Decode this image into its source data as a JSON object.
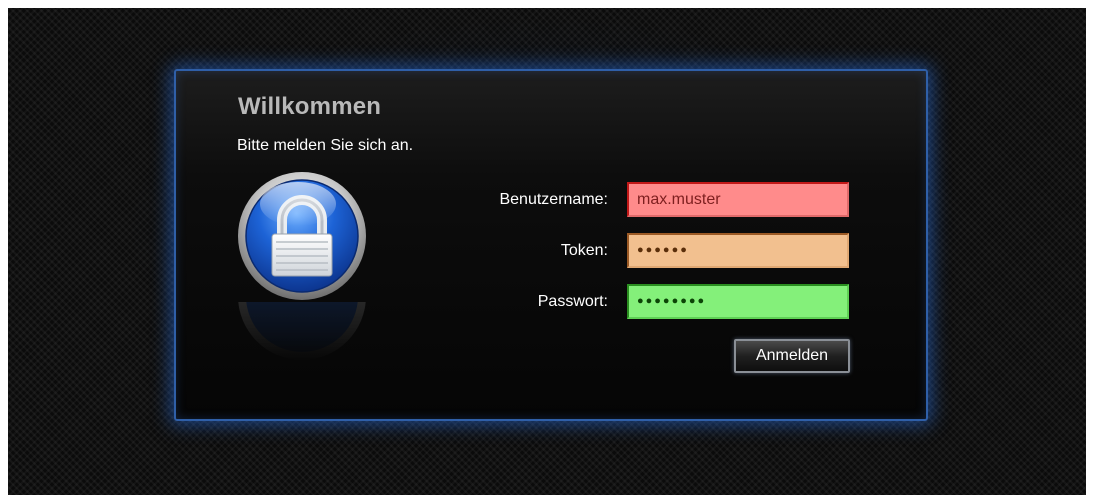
{
  "header": {
    "title": "Willkommen",
    "subtitle": "Bitte melden Sie sich an."
  },
  "lock_icon": "padlock-icon",
  "form": {
    "username": {
      "label": "Benutzername:",
      "value": "max.muster",
      "color": "#ff8b8b"
    },
    "token": {
      "label": "Token:",
      "value": "●●●●●●",
      "color": "#f2c08f"
    },
    "password": {
      "label": "Passwort:",
      "value": "●●●●●●●●",
      "color": "#84f07a"
    },
    "submit_label": "Anmelden"
  },
  "colors": {
    "accent": "#2f5fa8",
    "lock_blue": "#1c5fd0"
  }
}
